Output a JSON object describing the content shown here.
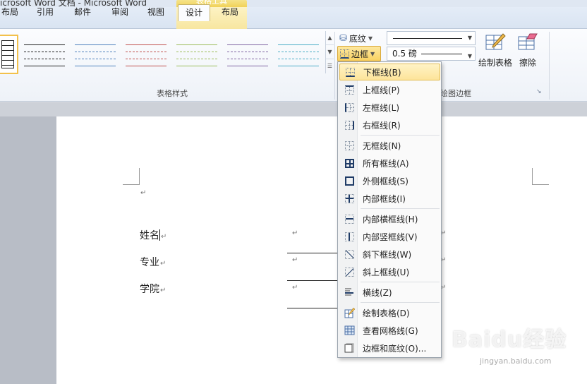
{
  "window": {
    "title": "icrosoft Word 文档 - Microsoft Word"
  },
  "tabs": [
    {
      "label": "布局"
    },
    {
      "label": "引用"
    },
    {
      "label": "邮件"
    },
    {
      "label": "审阅"
    },
    {
      "label": "视图"
    },
    {
      "label": "设计",
      "active": true
    },
    {
      "label": "布局"
    }
  ],
  "contextual_tab_group": "表格工具",
  "ribbon": {
    "table_styles_label": "表格样式",
    "draw_borders_label": "绘图边框",
    "shading_label": "底纹",
    "borders_label": "边框",
    "pen_weight": "0.5 磅",
    "draw_table_label": "绘制表格",
    "eraser_label": "擦除"
  },
  "document": {
    "fields": [
      {
        "label": "姓名"
      },
      {
        "label": "专业"
      },
      {
        "label": "学院"
      }
    ],
    "paragraph_mark": "↵"
  },
  "borders_menu": {
    "items": [
      {
        "label": "下框线(B)",
        "icon": "bottom-border-icon",
        "highlighted": true
      },
      {
        "label": "上框线(P)",
        "icon": "top-border-icon"
      },
      {
        "label": "左框线(L)",
        "icon": "left-border-icon"
      },
      {
        "label": "右框线(R)",
        "icon": "right-border-icon"
      },
      {
        "label": "无框线(N)",
        "icon": "no-border-icon"
      },
      {
        "label": "所有框线(A)",
        "icon": "all-borders-icon"
      },
      {
        "label": "外侧框线(S)",
        "icon": "outside-borders-icon"
      },
      {
        "label": "内部框线(I)",
        "icon": "inside-borders-icon"
      },
      {
        "label": "内部横框线(H)",
        "icon": "inside-horizontal-border-icon"
      },
      {
        "label": "内部竖框线(V)",
        "icon": "inside-vertical-border-icon"
      },
      {
        "label": "斜下框线(W)",
        "icon": "diagonal-down-border-icon"
      },
      {
        "label": "斜上框线(U)",
        "icon": "diagonal-up-border-icon"
      },
      {
        "label": "横线(Z)",
        "icon": "horizontal-line-icon"
      },
      {
        "label": "绘制表格(D)",
        "icon": "draw-table-icon"
      },
      {
        "label": "查看网格线(G)",
        "icon": "view-gridlines-icon"
      },
      {
        "label": "边框和底纹(O)...",
        "icon": "borders-and-shading-icon"
      }
    ]
  },
  "watermark": {
    "brand": "Baidu经验",
    "url": "jingyan.baidu.com"
  },
  "colors": {
    "menu_highlight": "#fde49a",
    "ribbon_bg": "#fbfcfe",
    "contextual_tab": "#f1d257"
  }
}
